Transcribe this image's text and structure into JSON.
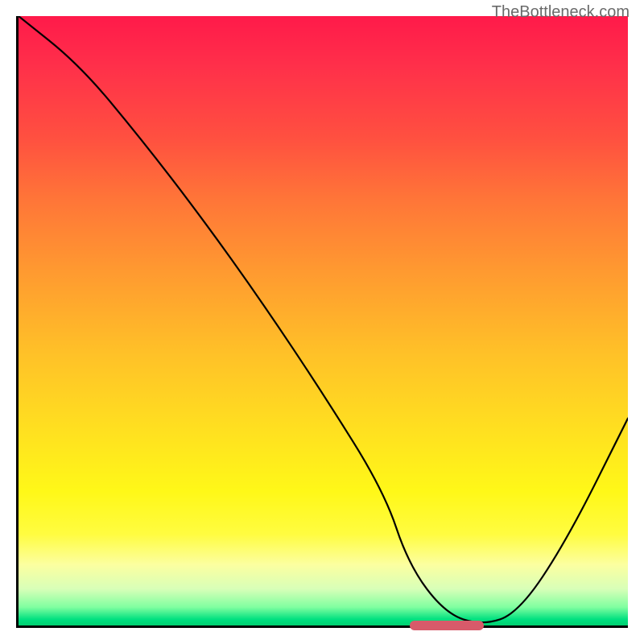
{
  "watermark": "TheBottleneck.com",
  "chart_data": {
    "type": "line",
    "title": "",
    "xlabel": "",
    "ylabel": "",
    "xlim": [
      0,
      100
    ],
    "ylim": [
      0,
      100
    ],
    "x": [
      0,
      10,
      20,
      30,
      40,
      50,
      60,
      64,
      70,
      76,
      82,
      90,
      100
    ],
    "values": [
      100,
      92,
      80,
      67,
      53,
      38,
      22,
      10,
      2,
      0,
      2,
      14,
      34
    ],
    "optimal_zone": {
      "start": 64,
      "end": 76,
      "value": 0
    },
    "background_gradient": {
      "top": "#ff1a4a",
      "mid": "#ffe020",
      "bottom": "#00d070"
    }
  }
}
